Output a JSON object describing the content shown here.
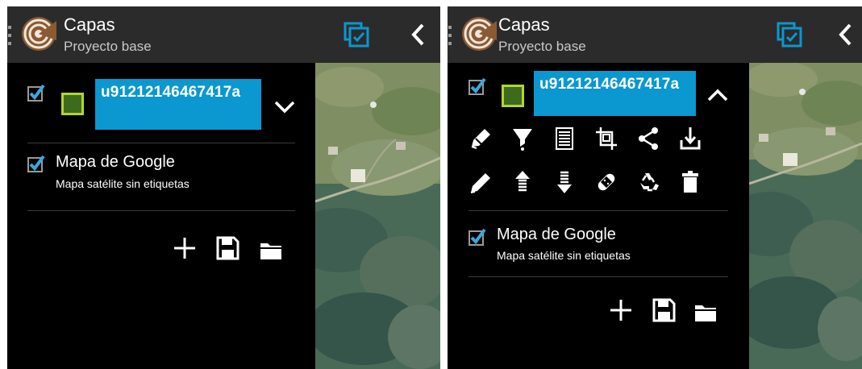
{
  "app": {
    "title": "Capas",
    "subtitle": "Proyecto base",
    "icons": [
      "drawer-handle-icon",
      "app-logo-icon",
      "select-layers-icon",
      "back-chevron-icon"
    ],
    "accent_color": "#0b97cf"
  },
  "layers": {
    "vector_layer": {
      "name": "u91212146467417a",
      "visible": true,
      "swatch_fill": "#3d6b1e",
      "swatch_border": "#b4d430"
    },
    "base_layer": {
      "title": "Mapa de Google",
      "subtitle": "Mapa satélite sin etiquetas",
      "visible": true
    }
  },
  "screens": [
    {
      "state": "collapsed",
      "expand_icon": "chevron-down-icon"
    },
    {
      "state": "expanded",
      "expand_icon": "chevron-up-icon",
      "layer_tools_row1": [
        "edit-style-icon",
        "filter-icon",
        "attribute-table-icon",
        "crop-extent-icon",
        "share-icon",
        "download-icon"
      ],
      "layer_tools_row2": [
        "pencil-icon",
        "move-up-icon",
        "move-down-icon",
        "bandage-icon",
        "recycle-icon",
        "trash-icon"
      ]
    }
  ],
  "footer_actions": [
    "add-layer-icon",
    "save-icon",
    "open-folder-icon"
  ]
}
